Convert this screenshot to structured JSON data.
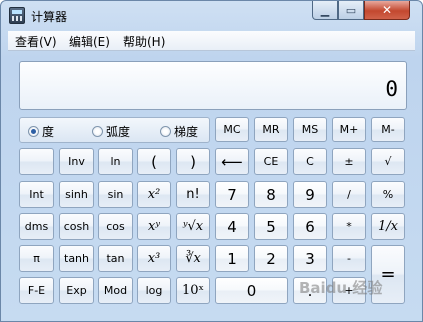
{
  "window": {
    "title": "计算器"
  },
  "menu": [
    "查看(V)",
    "编辑(E)",
    "帮助(H)"
  ],
  "display": {
    "value": "0"
  },
  "angle_modes": [
    {
      "label": "度",
      "selected": true
    },
    {
      "label": "弧度",
      "selected": false
    },
    {
      "label": "梯度",
      "selected": false
    }
  ],
  "buttons": {
    "mc": "MC",
    "mr": "MR",
    "ms": "MS",
    "mplus": "M+",
    "mminus": "M-",
    "inv": "Inv",
    "ln": "ln",
    "lparen": "(",
    "rparen": ")",
    "backspace": "⟵",
    "ce": "CE",
    "c": "C",
    "plusminus": "±",
    "sqrt": "√",
    "int": "Int",
    "sinh": "sinh",
    "sin": "sin",
    "x2": "x²",
    "nfact": "n!",
    "d7": "7",
    "d8": "8",
    "d9": "9",
    "divide": "/",
    "percent": "%",
    "dms": "dms",
    "cosh": "cosh",
    "cos": "cos",
    "xy": "xʸ",
    "yroot": "ʸ√x",
    "d4": "4",
    "d5": "5",
    "d6": "6",
    "multiply": "*",
    "recip": "1/x",
    "pi": "π",
    "tanh": "tanh",
    "tan": "tan",
    "x3": "x³",
    "cuberoot": "∛x",
    "d1": "1",
    "d2": "2",
    "d3": "3",
    "minus": "-",
    "equals": "=",
    "fe": "F-E",
    "exp": "Exp",
    "mod": "Mod",
    "log": "log",
    "tenx": "10ˣ",
    "d0": "0",
    "dot": ".",
    "plus": "+"
  },
  "watermark": "Baidu 经验"
}
